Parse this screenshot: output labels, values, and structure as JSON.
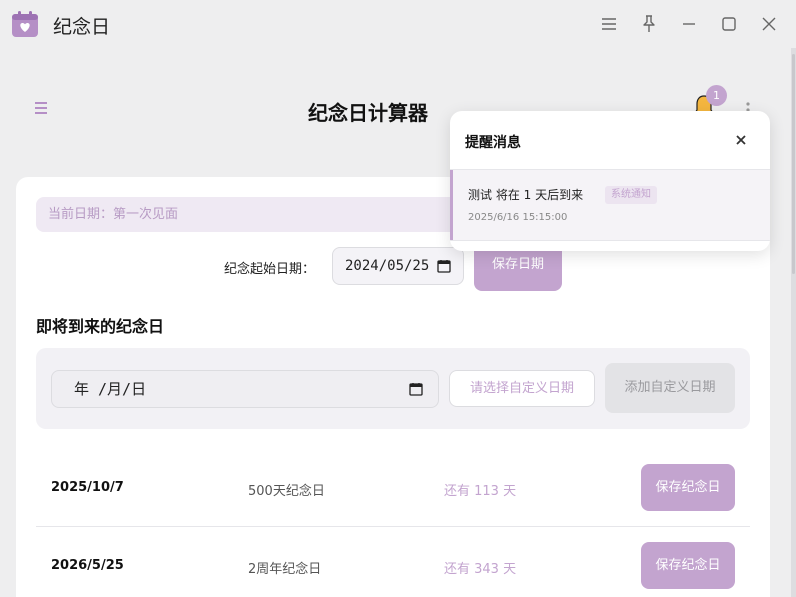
{
  "app": {
    "title": "纪念日",
    "accent": "#c3a4cf"
  },
  "window_controls": [
    "menu-icon",
    "pin-icon",
    "minimize-icon",
    "maximize-icon",
    "close-icon"
  ],
  "header": {
    "title": "纪念日计算器",
    "notification_count": "1"
  },
  "current": {
    "text": "当前日期：第一次见面"
  },
  "start": {
    "label": "纪念起始日期：",
    "value": "2024/05/25",
    "save_label": "保存日期"
  },
  "upcoming": {
    "title": "即将到来的纪念日",
    "custom_date_value": "年 /月/日",
    "custom_select_placeholder": "请选择自定义日期",
    "add_label": "添加自定义日期",
    "rows": [
      {
        "date": "2025/10/7",
        "name": "500天纪念日",
        "remain": "还有 113 天",
        "save_label": "保存纪念日"
      },
      {
        "date": "2026/5/25",
        "name": "2周年纪念日",
        "remain": "还有 343 天",
        "save_label": "保存纪念日"
      }
    ]
  },
  "popup": {
    "title": "提醒消息",
    "items": [
      {
        "text": "测试 将在 1 天后到来",
        "tag": "系统通知",
        "time": "2025/6/16 15:15:00"
      }
    ]
  }
}
